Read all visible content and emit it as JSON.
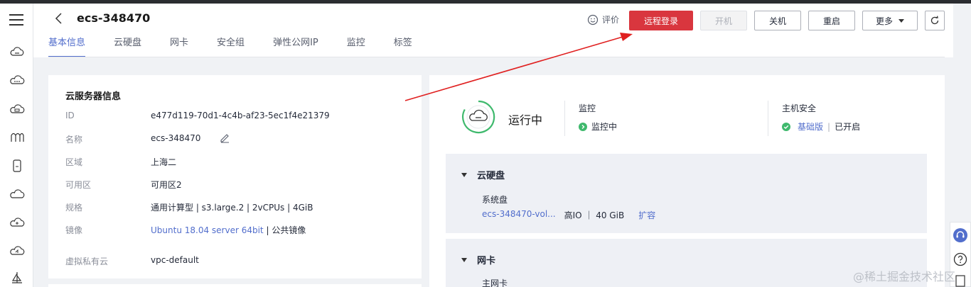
{
  "header": {
    "title": "ecs-348470",
    "rate_label": "评价",
    "buttons": {
      "remote_login": "远程登录",
      "power_on": "开机",
      "power_off": "关机",
      "restart": "重启",
      "more": "更多"
    }
  },
  "tabs": [
    "基本信息",
    "云硬盘",
    "网卡",
    "安全组",
    "弹性公网IP",
    "监控",
    "标签"
  ],
  "server_info": {
    "heading": "云服务器信息",
    "rows": [
      {
        "key": "ID",
        "value": "e477d119-70d1-4c4b-af23-5ec1f4e21379"
      },
      {
        "key": "名称",
        "value": "ecs-348470"
      },
      {
        "key": "区域",
        "value": "上海二"
      },
      {
        "key": "可用区",
        "value": "可用区2"
      },
      {
        "key": "规格",
        "value": "通用计算型 | s3.large.2 | 2vCPUs | 4GiB"
      },
      {
        "key": "镜像",
        "value_link": "Ubuntu 18.04 server 64bit",
        "value_rest": " | 公共镜像"
      },
      {
        "key": "虚拟私有云",
        "value": "vpc-default"
      }
    ]
  },
  "status": {
    "state": "运行中",
    "monitor_title": "监控",
    "monitor_value": "监控中",
    "security_title": "主机安全",
    "security_link": "基础版",
    "security_value": "已开启"
  },
  "disk_panel": {
    "title": "云硬盘",
    "sys_label": "系统盘",
    "disk_name": "ecs-348470-vol...",
    "disk_meta": "高IO ｜ 40 GiB",
    "expand": "扩容"
  },
  "nic_panel": {
    "title": "网卡",
    "main_nic": "主网卡"
  },
  "watermark": "@稀土掘金技术社区",
  "colors": {
    "accent": "#526ecc",
    "primary_button": "#d9363e",
    "running_green": "#3fb96d",
    "annotation_arrow": "#e02020"
  }
}
